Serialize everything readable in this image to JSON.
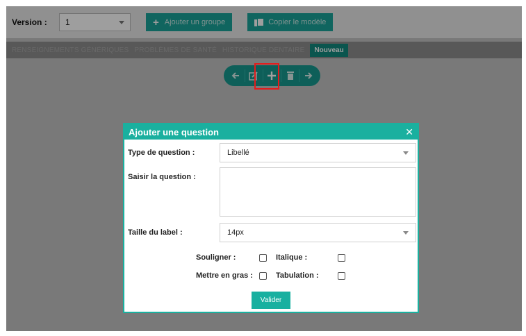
{
  "topbar": {
    "version_label": "Version :",
    "version_value": "1",
    "add_group_label": "Ajouter un groupe",
    "copy_model_label": "Copier le modèle"
  },
  "tabs": [
    {
      "label": "RENSEIGNEMENTS GÉNÉRIQUES"
    },
    {
      "label": "PROBLÈMES DE SANTÉ"
    },
    {
      "label": "HISTORIQUE DENTAIRE"
    },
    {
      "label": "Nouveau"
    }
  ],
  "toolbar": {
    "icons": [
      "arrow-left-icon",
      "edit-icon",
      "plus-icon",
      "trash-icon",
      "arrow-right-icon"
    ]
  },
  "modal": {
    "title": "Ajouter une question",
    "close_symbol": "✕",
    "type_label": "Type de question :",
    "type_value": "Libellé",
    "question_label": "Saisir la question :",
    "question_value": "",
    "size_label": "Taille du label :",
    "size_value": "14px",
    "underline_label": "Souligner :",
    "italic_label": "Italique :",
    "bold_label": "Mettre en gras :",
    "tab_label": "Tabulation :",
    "submit_label": "Valider"
  },
  "colors": {
    "accent": "#1ab09f",
    "highlight": "#e31b1b"
  }
}
